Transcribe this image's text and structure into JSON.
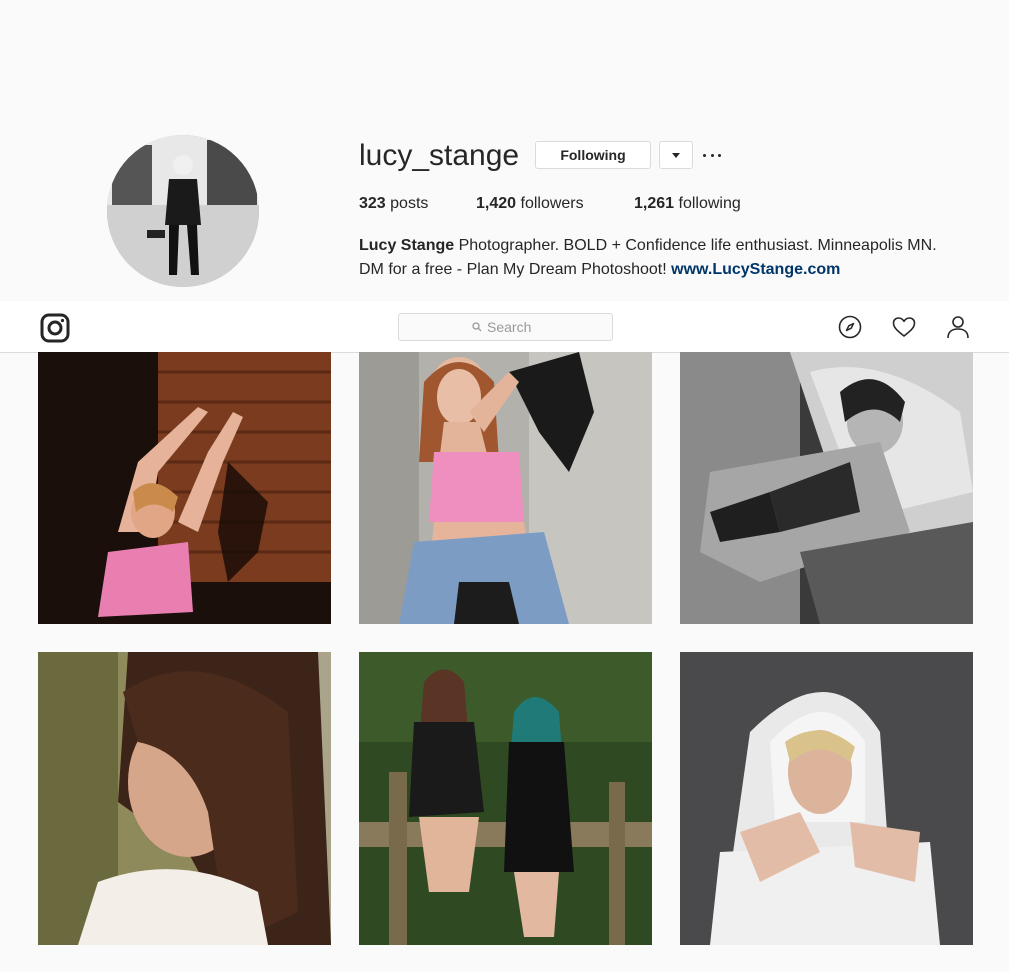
{
  "profile": {
    "username": "lucy_stange",
    "following_button": "Following",
    "stats": {
      "posts_count": "323",
      "posts_label": "posts",
      "followers_count": "1,420",
      "followers_label": "followers",
      "following_count": "1,261",
      "following_label": "following"
    },
    "bio": {
      "full_name": "Lucy Stange",
      "line1": " Photographer. BOLD + Confidence life enthusiast. Minneapolis MN.",
      "line2": "DM for a free - Plan My Dream Photoshoot! ",
      "link": "www.LucyStange.com"
    }
  },
  "navbar": {
    "search_placeholder": "Search",
    "icons": [
      "instagram-logo-icon",
      "search-icon",
      "explore-compass-icon",
      "activity-heart-icon",
      "profile-person-icon"
    ]
  },
  "posts": [
    {
      "description": "woman in pink crop top posing against rusted metal wall"
    },
    {
      "description": "woman in pink top with denim jacket against concrete wall"
    },
    {
      "description": "black and white boudoir portrait with fur coat"
    },
    {
      "description": "close-up portrait of woman with long brown hair"
    },
    {
      "description": "two women in black lace dresses on wooden fence"
    },
    {
      "description": "woman in white hoodie portrait"
    }
  ],
  "colors": {
    "background": "#fafafa",
    "text": "#262626",
    "link": "#003569",
    "border": "#dbdbdb"
  }
}
